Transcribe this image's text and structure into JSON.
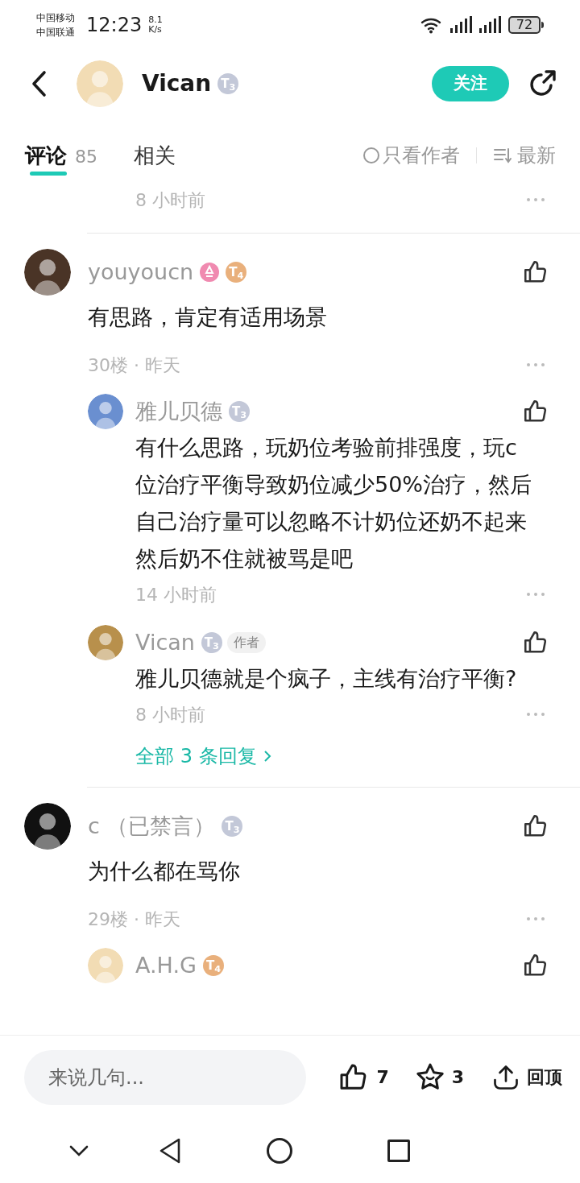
{
  "status_bar": {
    "carriers": [
      "中国移动",
      "中国联通"
    ],
    "time": "12:23",
    "speed": [
      "8.1",
      "K/s"
    ],
    "battery": "72"
  },
  "header": {
    "name": "Vican",
    "badges": [
      {
        "kind": "tier",
        "text": "T$_{3}$",
        "color": "#c3c8d8"
      }
    ],
    "follow": "关注"
  },
  "tabs": [
    {
      "label": "评论",
      "count": "85",
      "selected": true
    },
    {
      "label": "相关",
      "selected": false
    }
  ],
  "filters": {
    "author_only": {
      "label": "只看作者",
      "checked": false
    },
    "sort": "最新"
  },
  "previous_tail": {
    "meta": "8 小时前"
  },
  "threads": [
    {
      "name": "youyoucn",
      "badges": [
        {
          "kind": "medal",
          "color": "#f08ab0"
        },
        {
          "kind": "tier",
          "text": "T$_{4}$",
          "color": "#e9b07c"
        }
      ],
      "body": "有思路，肯定有适用场景",
      "meta": "30楼 · 昨天",
      "replies": [
        {
          "name": "雅儿贝德",
          "badges": [
            {
              "kind": "tier",
              "text": "T$_{3}$",
              "color": "#c3c8d8"
            }
          ],
          "body": "有什么思路，玩奶位考验前排强度，玩c位治疗平衡导致奶位减少50%治疗，然后自己治疗量可以忽略不计奶位还奶不起来然后奶不住就被骂是吧",
          "meta": "14 小时前"
        },
        {
          "name": "Vican",
          "badges": [
            {
              "kind": "tier",
              "text": "T$_{3}$",
              "color": "#c3c8d8"
            },
            {
              "kind": "tag",
              "text": "作者"
            }
          ],
          "body": "雅儿贝德就是个疯子，主线有治疗平衡?",
          "meta": "8 小时前"
        }
      ],
      "more_replies": "全部 3 条回复"
    },
    {
      "name": "c （已禁言）",
      "badges": [
        {
          "kind": "tier",
          "text": "T$_{3}$",
          "color": "#c3c8d8"
        }
      ],
      "body": "为什么都在骂你",
      "meta": "29楼 · 昨天",
      "replies": [
        {
          "name": "A.H.G",
          "badges": [
            {
              "kind": "tier",
              "text": "T$_{4}$",
              "color": "#e9b07c"
            }
          ]
        }
      ]
    }
  ],
  "bottom_bar": {
    "placeholder": "来说几句...",
    "likes": "7",
    "favorites": "3",
    "top": "回顶"
  }
}
